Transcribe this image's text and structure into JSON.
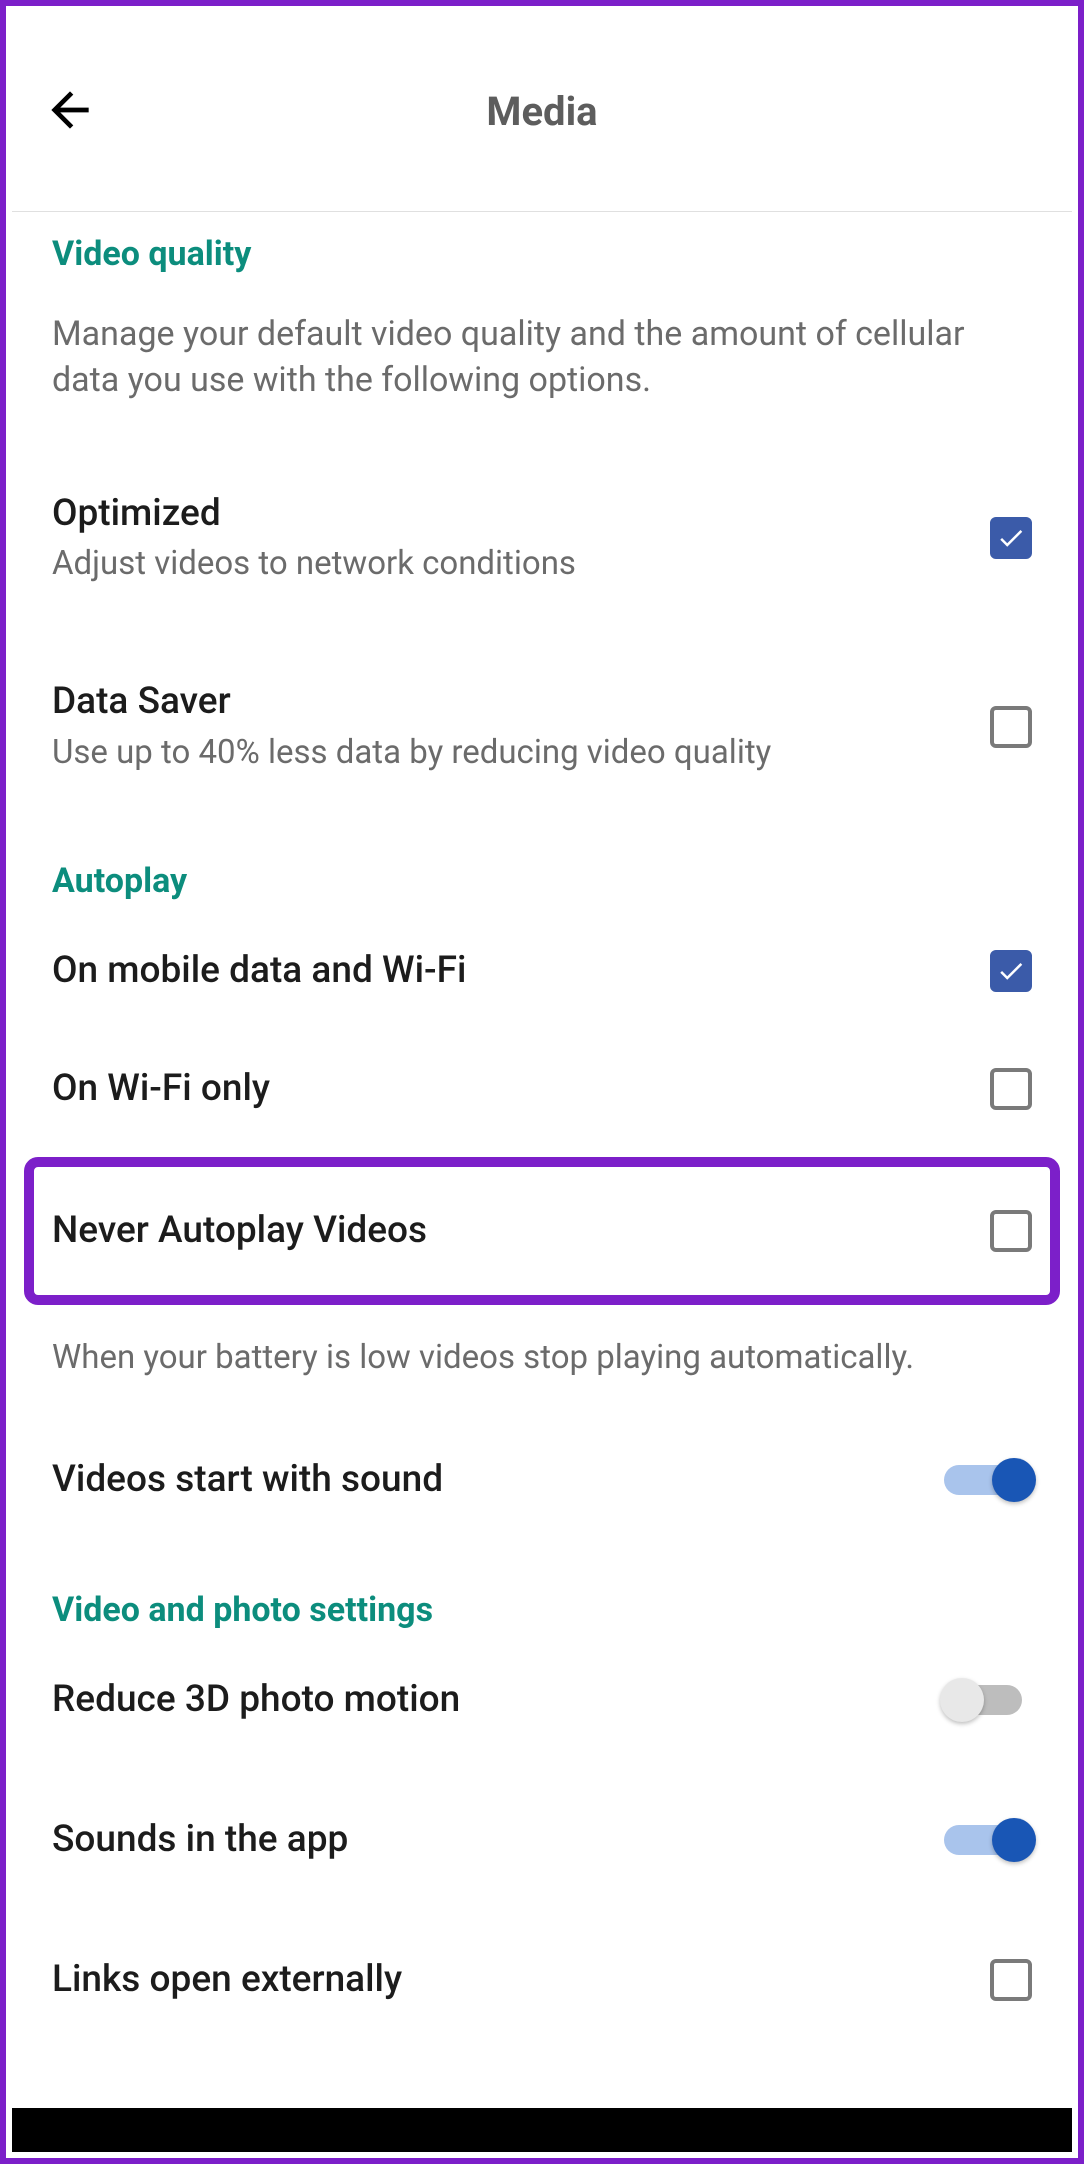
{
  "header": {
    "title": "Media"
  },
  "sections": {
    "video_quality": {
      "header": "Video quality",
      "description": "Manage your default video quality and the amount of cellular data you use with the following options.",
      "options": [
        {
          "title": "Optimized",
          "sub": "Adjust videos to network conditions",
          "checked": true
        },
        {
          "title": "Data Saver",
          "sub": "Use up to 40% less data by reducing video quality",
          "checked": false
        }
      ]
    },
    "autoplay": {
      "header": "Autoplay",
      "options": [
        {
          "title": "On mobile data and Wi-Fi",
          "checked": true
        },
        {
          "title": "On Wi-Fi only",
          "checked": false
        },
        {
          "title": "Never Autoplay Videos",
          "checked": false
        }
      ],
      "footnote": "When your battery is low videos stop playing automatically."
    },
    "sound": {
      "title": "Videos start with sound",
      "on": true
    },
    "video_photo": {
      "header": "Video and photo settings",
      "options": [
        {
          "title": "Reduce 3D photo motion",
          "type": "toggle",
          "on": false
        },
        {
          "title": "Sounds in the app",
          "type": "toggle",
          "on": true
        },
        {
          "title": "Links open externally",
          "type": "checkbox",
          "checked": false
        }
      ]
    }
  }
}
